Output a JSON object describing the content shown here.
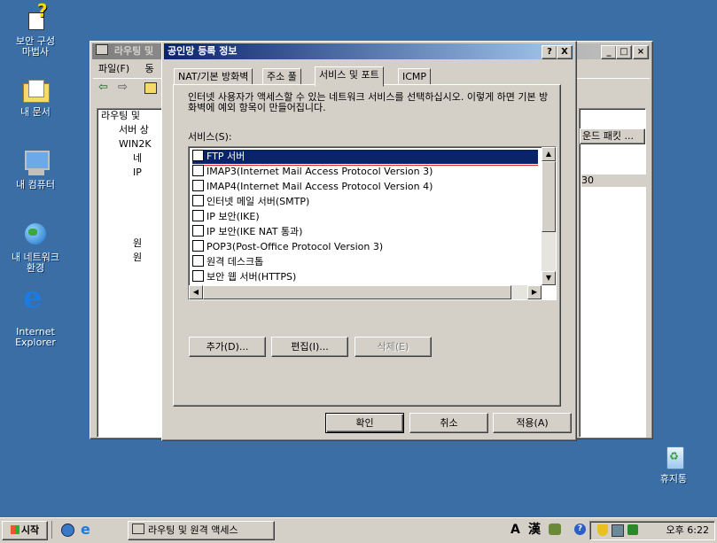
{
  "desktop": {
    "icons": [
      {
        "label": "보안 구성\n마법사"
      },
      {
        "label": "내 문서"
      },
      {
        "label": "내 컴퓨터"
      },
      {
        "label": "내 네트워크\n환경"
      },
      {
        "label": "Internet\nExplorer"
      },
      {
        "label": "휴지통"
      }
    ]
  },
  "main_window": {
    "title": "라우팅 및",
    "menu": {
      "file": "파일(F)",
      "action": "동"
    },
    "tree": [
      "라우팅 및",
      "서버 상",
      "WIN2K",
      "네",
      "IP",
      "",
      "",
      "",
      "",
      "원",
      "원"
    ],
    "right_header": "운드 패킷 ...",
    "right_value": "30"
  },
  "dialog": {
    "title": "공인망 등록 정보",
    "help_btn": "?",
    "close_btn": "X",
    "tabs": [
      "NAT/기본 방화벽",
      "주소 풀",
      "서비스 및 포트",
      "ICMP"
    ],
    "description": "인터넷 사용자가 액세스할 수 있는 네트워크 서비스를 선택하십시오. 이렇게 하면 기본 방화벽에 예외 항목이 만들어집니다.",
    "services_label": "서비스(S):",
    "services": [
      "FTP 서버",
      "IMAP3(Internet Mail Access Protocol Version 3)",
      "IMAP4(Internet Mail Access Protocol Version 4)",
      "인터넷 메일 서버(SMTP)",
      "IP 보안(IKE)",
      "IP 보안(IKE NAT 통과)",
      "POP3(Post-Office Protocol Version 3)",
      "원격 데스크톱",
      "보안 웹 서버(HTTPS)"
    ],
    "buttons": {
      "add": "추가(D)...",
      "edit": "편집(I)...",
      "delete": "삭제(E)"
    },
    "footer": {
      "ok": "확인",
      "cancel": "취소",
      "apply": "적용(A)"
    }
  },
  "taskbar": {
    "start": "시작",
    "task": "라우팅 및 원격 액세스",
    "ime_a": "A",
    "ime_han": "漢",
    "clock": "오후 6:22"
  }
}
